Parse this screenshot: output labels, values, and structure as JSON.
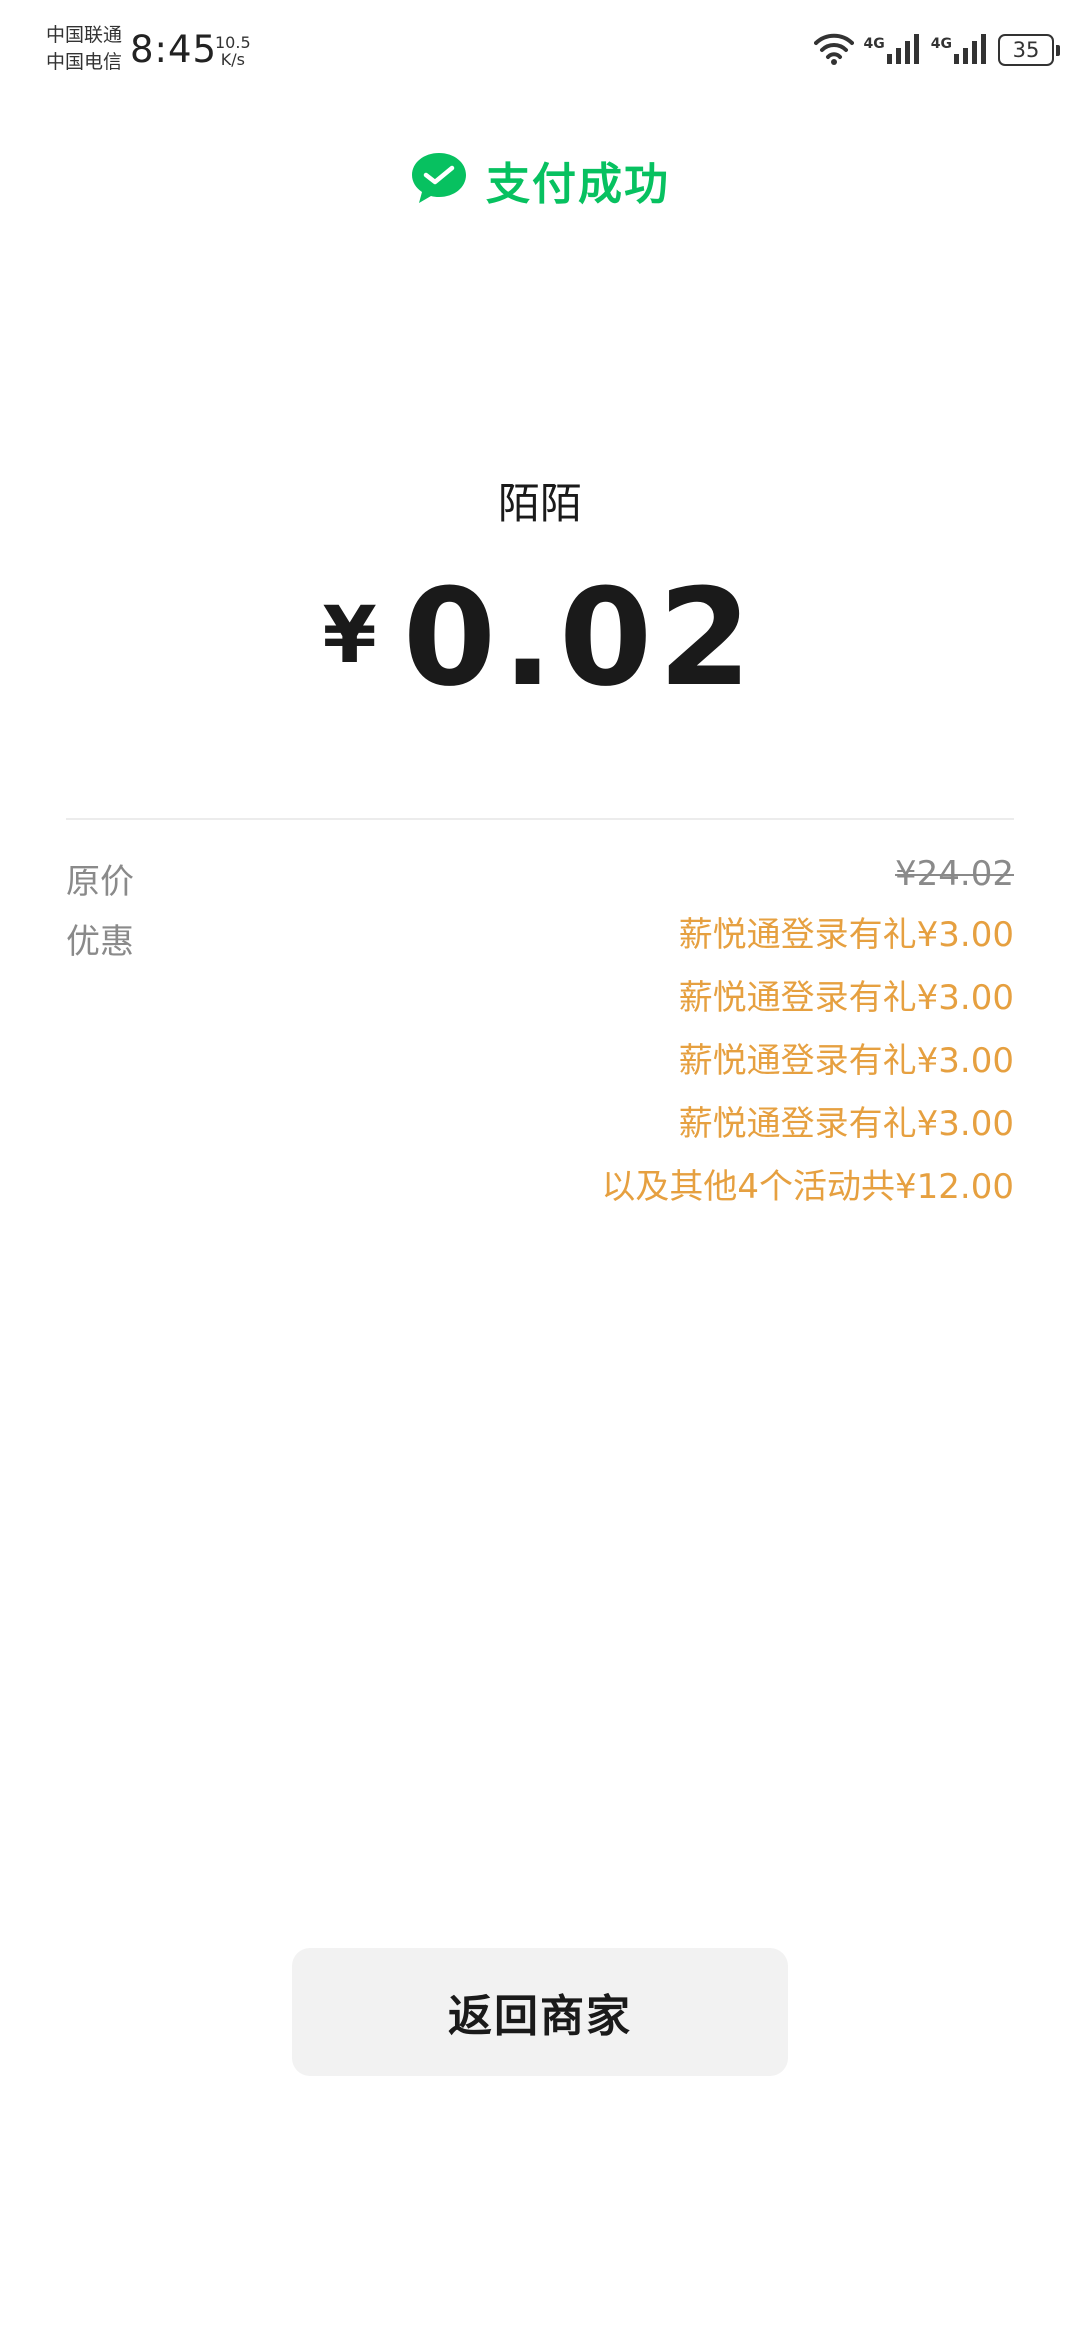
{
  "status_bar": {
    "carrier_1": "中国联通",
    "carrier_2": "中国电信",
    "time": "8:45",
    "net_speed_value": "10.5",
    "net_speed_unit": "K/s",
    "sim1_network": "4G",
    "sim2_network": "4G",
    "battery_level": "35"
  },
  "header": {
    "title": "支付成功",
    "accent_color": "#07c160"
  },
  "payment": {
    "merchant": "陌陌",
    "currency_symbol": "¥",
    "amount": "0.02"
  },
  "details": {
    "original_price_label": "原价",
    "original_price_value": "¥24.02",
    "discount_label": "优惠",
    "discount_color": "#e6a040",
    "discounts": [
      "薪悦通登录有礼¥3.00",
      "薪悦通登录有礼¥3.00",
      "薪悦通登录有礼¥3.00",
      "薪悦通登录有礼¥3.00",
      "以及其他4个活动共¥12.00"
    ]
  },
  "actions": {
    "back_label": "返回商家"
  }
}
